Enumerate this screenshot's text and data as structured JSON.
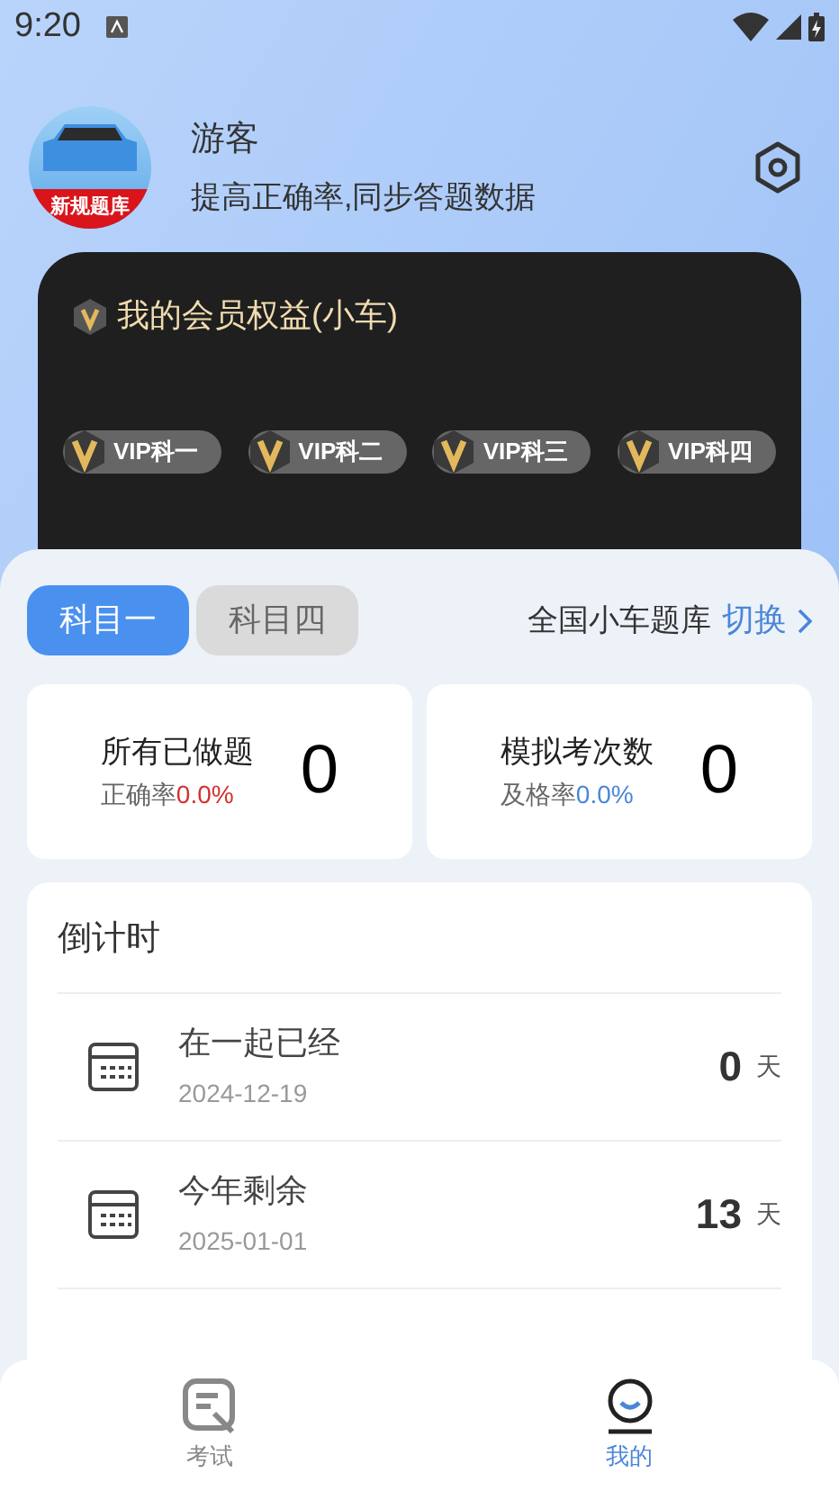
{
  "status_bar": {
    "time": "9:20"
  },
  "profile": {
    "name": "游客",
    "subtitle": "提高正确率,同步答题数据",
    "avatar_text": "新规题库"
  },
  "vip_card": {
    "title": "我的会员权益(小车)",
    "badges": [
      "VIP科一",
      "VIP科二",
      "VIP科三",
      "VIP科四"
    ]
  },
  "subject_tabs": [
    {
      "label": "科目一",
      "selected": true
    },
    {
      "label": "科目四",
      "selected": false
    }
  ],
  "bank": {
    "label": "全国小车题库",
    "action": "切换"
  },
  "stats": [
    {
      "title": "所有已做题",
      "rate_label": "正确率",
      "rate_value": "0.0%",
      "color": "#d0312d",
      "count": "0"
    },
    {
      "title": "模拟考次数",
      "rate_label": "及格率",
      "rate_value": "0.0%",
      "color": "#4a86d8",
      "count": "0"
    }
  ],
  "countdown": {
    "title": "倒计时",
    "rows": [
      {
        "label": "在一起已经",
        "date": "2024-12-19",
        "value": "0",
        "unit": "天"
      },
      {
        "label": "今年剩余",
        "date": "2025-01-01",
        "value": "13",
        "unit": "天"
      }
    ]
  },
  "bottom_nav": [
    {
      "label": "考试",
      "kind": "exam",
      "selected": false
    },
    {
      "label": "我的",
      "kind": "me",
      "selected": true
    }
  ]
}
